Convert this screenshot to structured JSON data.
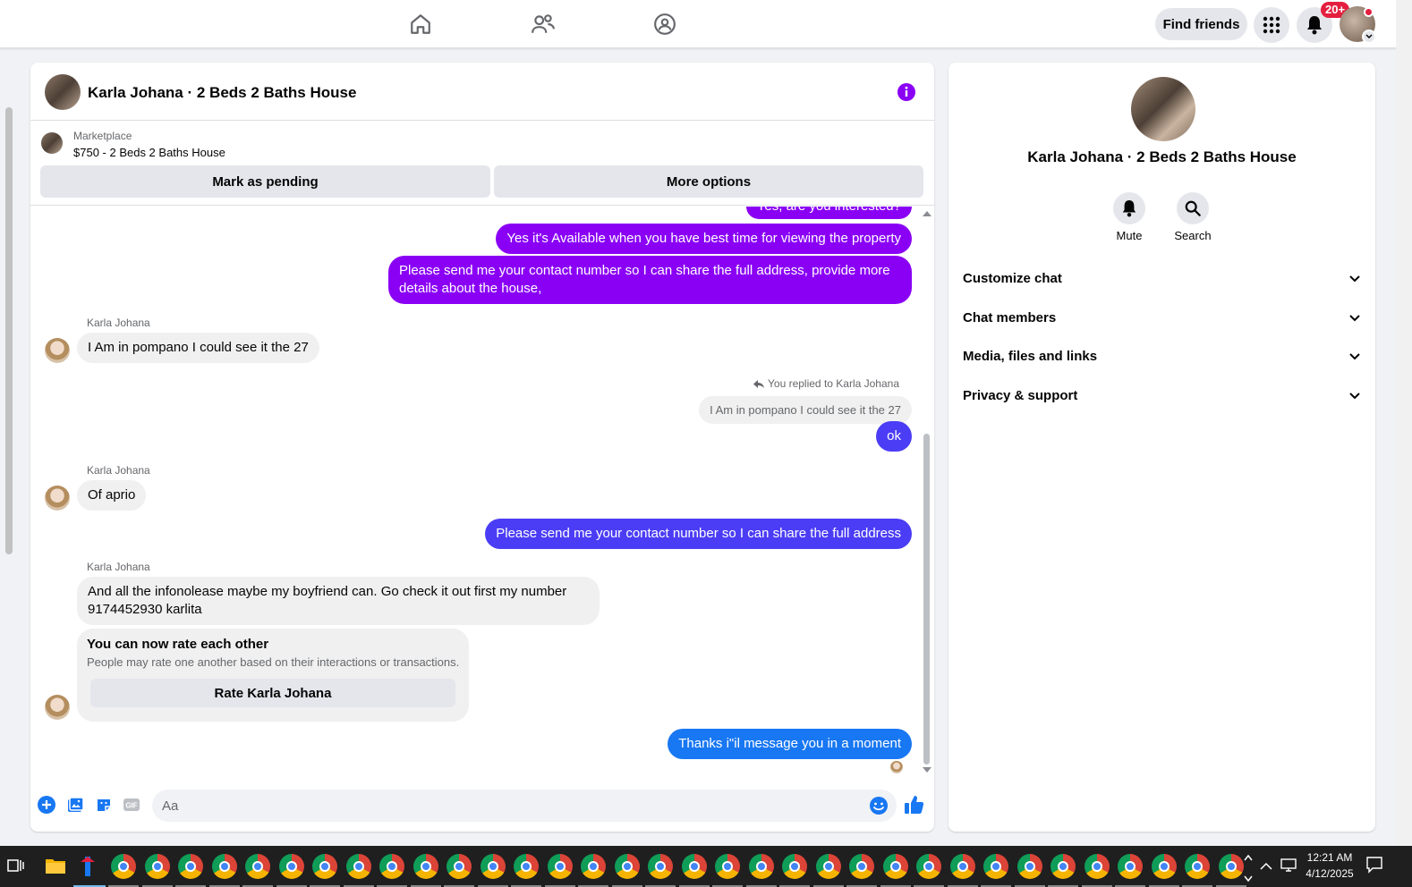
{
  "nav": {
    "find_friends": "Find friends",
    "notif_count": "20+"
  },
  "chat": {
    "title": "Karla Johana · 2 Beds 2 Baths House",
    "marketplace_label": "Marketplace",
    "listing": "$750 - 2 Beds 2 Baths House",
    "btn_pending": "Mark as pending",
    "btn_more": "More options",
    "messages": {
      "m0": "Yes, are you interested?",
      "m1": "Yes it's Available when you have best time for viewing the property",
      "m2": "Please send me your contact number so I can share the full address, provide more details about the house,",
      "sender": "Karla Johana",
      "m3": "I Am in pompano I could see it the 27",
      "replied": "You replied to Karla Johana",
      "quote": "I Am in pompano I could see it the 27",
      "m4": "ok",
      "m5": "Of aprio",
      "m6": "Please send me your contact number so I can share the full address",
      "m7": "And all the infonolease maybe my boyfriend can. Go check it out first my number 9174452930 karlita",
      "rate_title": "You can now rate each other",
      "rate_sub": "People may rate one another based on their interactions or transactions.",
      "rate_btn": "Rate Karla Johana",
      "m8": "Thanks i\"il message you in a moment"
    },
    "composer_placeholder": "Aa"
  },
  "info": {
    "name": "Karla Johana · 2 Beds 2 Baths House",
    "mute": "Mute",
    "search": "Search",
    "sections": [
      "Customize chat",
      "Chat members",
      "Media, files and links",
      "Privacy & support"
    ]
  },
  "taskbar": {
    "time": "12:21 AM",
    "date": "4/12/2025"
  },
  "colors": {
    "accent_purple": "#8a00f5",
    "bubble_blue": "#4b3df5",
    "fb_blue": "#1877f2"
  }
}
